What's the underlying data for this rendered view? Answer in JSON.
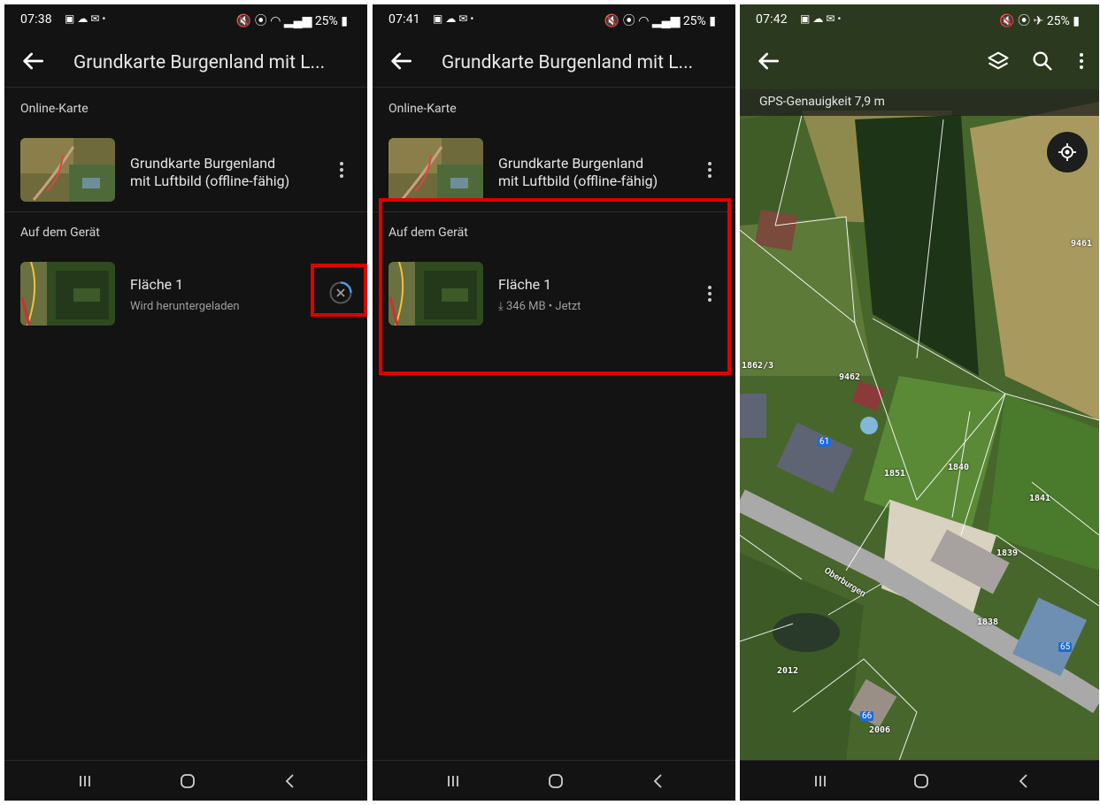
{
  "screens": [
    {
      "status": {
        "time": "07:38",
        "battery": "25%"
      },
      "app_title": "Grundkarte Burgenland mit L...",
      "online_section": "Online-Karte",
      "online_map": {
        "title_line1": "Grundkarte Burgenland",
        "title_line2": "mit Luftbild (offline-fähig)"
      },
      "device_section": "Auf dem Gerät",
      "device_map": {
        "title": "Fläche 1",
        "subtitle": "Wird heruntergeladen"
      }
    },
    {
      "status": {
        "time": "07:41",
        "battery": "25%"
      },
      "app_title": "Grundkarte Burgenland mit L...",
      "online_section": "Online-Karte",
      "online_map": {
        "title_line1": "Grundkarte Burgenland",
        "title_line2": "mit Luftbild (offline-fähig)"
      },
      "device_section": "Auf dem Gerät",
      "device_map": {
        "title": "Fläche 1",
        "subtitle": "346 MB • Jetzt"
      }
    },
    {
      "status": {
        "time": "07:42",
        "battery": "25%"
      },
      "gps_accuracy": "GPS-Genauigkeit 7,9 m",
      "parcels": [
        "9461",
        "1862/3",
        "9462",
        "1851",
        "1840",
        "1841",
        "1839",
        "1838",
        "2012",
        "2006"
      ],
      "house_numbers": [
        "61",
        "65",
        "66"
      ],
      "street": "Oberburgen"
    }
  ],
  "icons": {
    "back": "arrow-left-icon",
    "more": "more-vertical-icon",
    "cancel": "cancel-download-icon",
    "layers": "layers-icon",
    "search": "search-icon",
    "locate": "locate-icon",
    "nav_recents": "recents-icon",
    "nav_home": "home-icon",
    "nav_back": "nav-back-icon"
  },
  "colors": {
    "background": "#131313",
    "highlight": "#e00000",
    "accent": "#3a8be0"
  }
}
